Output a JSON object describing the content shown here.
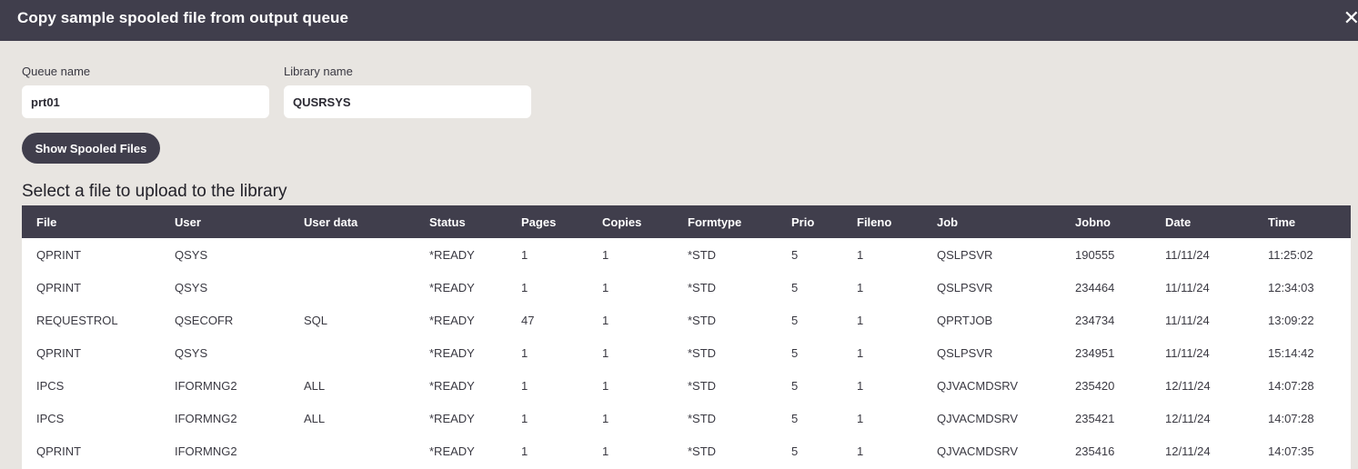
{
  "dialog": {
    "title": "Copy sample spooled file from output queue",
    "close_glyph": "✕"
  },
  "form": {
    "queue_label": "Queue name",
    "queue_value": "prt01",
    "library_label": "Library name",
    "library_value": "QUSRSYS",
    "show_button": "Show Spooled Files"
  },
  "section_title": "Select a file to upload to the library",
  "table": {
    "columns": [
      "File",
      "User",
      "User data",
      "Status",
      "Pages",
      "Copies",
      "Formtype",
      "Prio",
      "Fileno",
      "Job",
      "Jobno",
      "Date",
      "Time"
    ],
    "rows": [
      [
        "QPRINT",
        "QSYS",
        "",
        "*READY",
        "1",
        "1",
        "*STD",
        "5",
        "1",
        "QSLPSVR",
        "190555",
        "11/11/24",
        "11:25:02"
      ],
      [
        "QPRINT",
        "QSYS",
        "",
        "*READY",
        "1",
        "1",
        "*STD",
        "5",
        "1",
        "QSLPSVR",
        "234464",
        "11/11/24",
        "12:34:03"
      ],
      [
        "REQUESTROL",
        "QSECOFR",
        "SQL",
        "*READY",
        "47",
        "1",
        "*STD",
        "5",
        "1",
        "QPRTJOB",
        "234734",
        "11/11/24",
        "13:09:22"
      ],
      [
        "QPRINT",
        "QSYS",
        "",
        "*READY",
        "1",
        "1",
        "*STD",
        "5",
        "1",
        "QSLPSVR",
        "234951",
        "11/11/24",
        "15:14:42"
      ],
      [
        "IPCS",
        "IFORMNG2",
        "ALL",
        "*READY",
        "1",
        "1",
        "*STD",
        "5",
        "1",
        "QJVACMDSRV",
        "235420",
        "12/11/24",
        "14:07:28"
      ],
      [
        "IPCS",
        "IFORMNG2",
        "ALL",
        "*READY",
        "1",
        "1",
        "*STD",
        "5",
        "1",
        "QJVACMDSRV",
        "235421",
        "12/11/24",
        "14:07:28"
      ],
      [
        "QPRINT",
        "IFORMNG2",
        "",
        "*READY",
        "1",
        "1",
        "*STD",
        "5",
        "1",
        "QJVACMDSRV",
        "235416",
        "12/11/24",
        "14:07:35"
      ]
    ]
  },
  "colors": {
    "header_bg": "#403e4c",
    "page_bg": "#e8e5e1",
    "row_bg": "#ffffff"
  }
}
